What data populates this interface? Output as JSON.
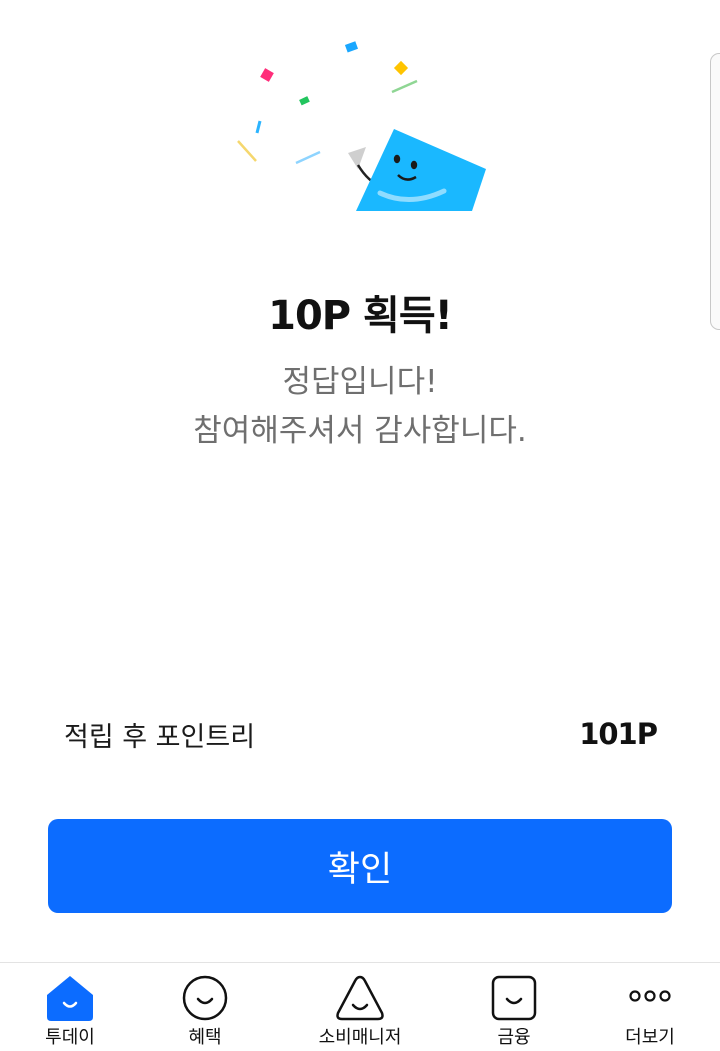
{
  "result": {
    "title": "10P 획득!",
    "message_line1": "정답입니다!",
    "message_line2": "참여해주셔서 감사합니다."
  },
  "points": {
    "label": "적립 후 포인트리",
    "value": "101P"
  },
  "confirm_button": {
    "label": "확인",
    "color": "#0c6cff"
  },
  "tabbar": {
    "tabs": [
      {
        "label": "투데이",
        "icon": "home-face-icon",
        "active": true
      },
      {
        "label": "혜택",
        "icon": "circle-face-icon",
        "active": false
      },
      {
        "label": "소비매니저",
        "icon": "triangle-face-icon",
        "active": false
      },
      {
        "label": "금융",
        "icon": "square-face-icon",
        "active": false
      },
      {
        "label": "더보기",
        "icon": "more-dots-icon",
        "active": false
      }
    ]
  }
}
